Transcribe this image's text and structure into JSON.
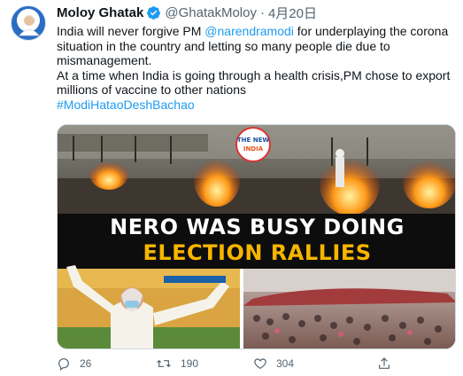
{
  "tweet": {
    "author": {
      "display_name": "Moloy Ghatak",
      "verified_icon": "verified-badge-icon",
      "handle": "@GhatakMoloy",
      "separator": "·",
      "date": "4月20日"
    },
    "text": {
      "line1_before": "India will never forgive PM ",
      "mention": "@narendramodi",
      "line1_after": " for underplaying the corona",
      "line2": "situation in the country and letting so many people die due to",
      "line3": "mismanagement.",
      "line4": "At a time when India is going through a health crisis,PM chose to export",
      "line5": "millions of vaccine to other nations",
      "hashtag": "#ModiHataoDeshBachao"
    },
    "media": {
      "headline_line1": "NERO WAS BUSY DOING",
      "headline_line2": "ELECTION RALLIES",
      "logo_text_top": "THE NEW",
      "logo_text_bottom": "INDIA"
    },
    "actions": {
      "reply_count": "26",
      "retweet_count": "190",
      "like_count": "304"
    }
  },
  "colors": {
    "link": "#1d9bf0",
    "text": "#0f1419",
    "secondary": "#536471",
    "headline_accent": "#f7b500"
  }
}
